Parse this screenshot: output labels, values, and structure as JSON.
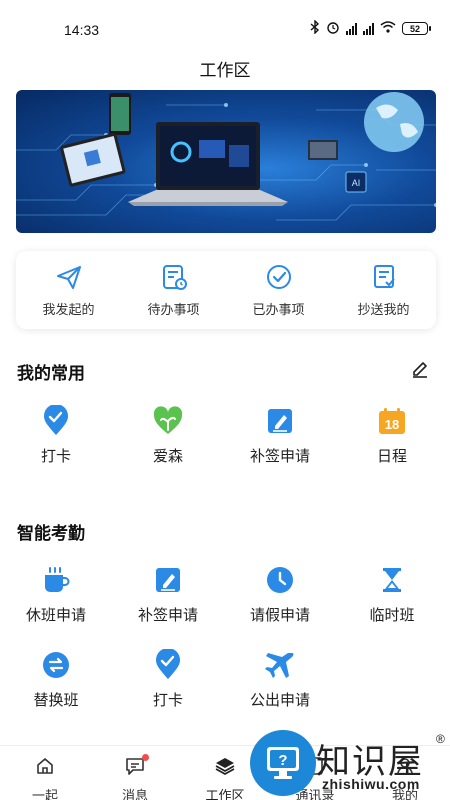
{
  "status_bar": {
    "time": "14:33",
    "battery": "52"
  },
  "page": {
    "title": "工作区"
  },
  "quick_actions": [
    {
      "label": "我发起的",
      "icon": "paper-plane-icon"
    },
    {
      "label": "待办事项",
      "icon": "todo-clock-icon"
    },
    {
      "label": "已办事项",
      "icon": "check-circle-icon"
    },
    {
      "label": "抄送我的",
      "icon": "cc-doc-icon"
    }
  ],
  "favorites": {
    "title": "我的常用",
    "items": [
      {
        "label": "打卡",
        "icon": "location-check-icon"
      },
      {
        "label": "爱森",
        "icon": "heart-sprout-icon"
      },
      {
        "label": "补签申请",
        "icon": "edit-doc-icon"
      },
      {
        "label": "日程",
        "icon": "calendar-icon",
        "day": "18"
      }
    ]
  },
  "attendance": {
    "title": "智能考勤",
    "items": [
      {
        "label": "休班申请",
        "icon": "coffee-cup-icon"
      },
      {
        "label": "补签申请",
        "icon": "edit-doc-icon"
      },
      {
        "label": "请假申请",
        "icon": "clock-icon"
      },
      {
        "label": "临时班",
        "icon": "hourglass-icon"
      },
      {
        "label": "替换班",
        "icon": "swap-icon"
      },
      {
        "label": "打卡",
        "icon": "location-check-icon"
      },
      {
        "label": "公出申请",
        "icon": "airplane-icon"
      }
    ]
  },
  "tabbar": [
    {
      "label": "一起",
      "icon": "home-icon"
    },
    {
      "label": "消息",
      "icon": "chat-icon",
      "badge": true
    },
    {
      "label": "工作区",
      "icon": "layers-icon",
      "active": true
    },
    {
      "label": "通讯录",
      "icon": "contacts-icon"
    },
    {
      "label": "我的",
      "icon": "user-icon"
    }
  ],
  "watermark": {
    "name": "知识屋",
    "domain": "zhishiwu.com",
    "mark": "®"
  },
  "colors": {
    "accent": "#2b8ae6",
    "green": "#5cc24f",
    "orange": "#f5a623",
    "badge": "#f04e4e"
  }
}
